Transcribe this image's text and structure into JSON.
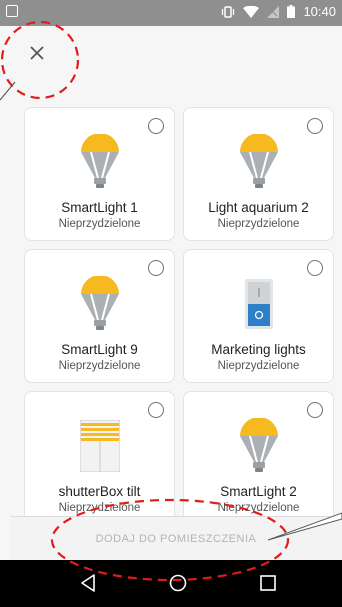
{
  "status_bar": {
    "time": "10:40"
  },
  "header": {
    "close_icon": "close-icon"
  },
  "devices": [
    {
      "name": "SmartLight 1",
      "status": "Nieprzydzielone",
      "icon": "bulb-icon"
    },
    {
      "name": "Light aquarium 2",
      "status": "Nieprzydzielone",
      "icon": "bulb-icon"
    },
    {
      "name": "SmartLight 9",
      "status": "Nieprzydzielone",
      "icon": "bulb-icon"
    },
    {
      "name": "Marketing lights",
      "status": "Nieprzydzielone",
      "icon": "switch-icon"
    },
    {
      "name": "shutterBox tilt",
      "status": "Nieprzydzielone",
      "icon": "shutter-icon"
    },
    {
      "name": "SmartLight 2",
      "status": "Nieprzydzielone",
      "icon": "bulb-icon"
    }
  ],
  "footer": {
    "assign_button": "DODAJ DO POMIESZCZENIA"
  },
  "navigation": {
    "back": "back-icon",
    "home": "home-icon",
    "recents": "recents-icon"
  },
  "colors": {
    "bulb": "#f6b91f",
    "bulb_body": "#aab0b3",
    "switch": "#2d7fc7",
    "annotation": "#e21b1b"
  }
}
